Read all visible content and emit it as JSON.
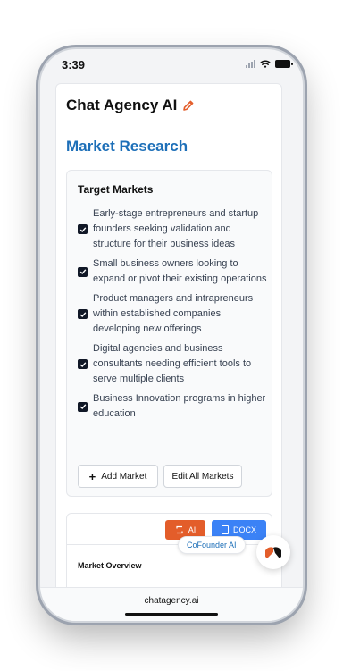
{
  "status": {
    "time": "3:39"
  },
  "app": {
    "title": "Chat Agency AI"
  },
  "section": {
    "title": "Market Research"
  },
  "target_markets": {
    "heading": "Target Markets",
    "items": [
      {
        "label": "Early-stage entrepreneurs and startup founders seeking validation and structure for their business ideas",
        "checked": true
      },
      {
        "label": "Small business owners looking to expand or pivot their existing operations",
        "checked": true
      },
      {
        "label": "Product managers and intrapreneurs within established companies developing new offerings",
        "checked": true
      },
      {
        "label": "Digital agencies and business consultants needing efficient tools to serve multiple clients",
        "checked": true
      },
      {
        "label": "Business Innovation programs in higher education",
        "checked": true
      }
    ],
    "add_label": "Add Market",
    "edit_all_label": "Edit All Markets"
  },
  "overview": {
    "ai_label": "AI",
    "docx_label": "DOCX",
    "title": "Market Overview"
  },
  "assistant": {
    "tooltip": "CoFounder AI"
  },
  "browser": {
    "url": "chatagency.ai"
  },
  "colors": {
    "accent": "#1d6fb8",
    "ai_button": "#e35d2a",
    "docx_button": "#3b82f6",
    "edit_icon": "#e35d2a"
  }
}
